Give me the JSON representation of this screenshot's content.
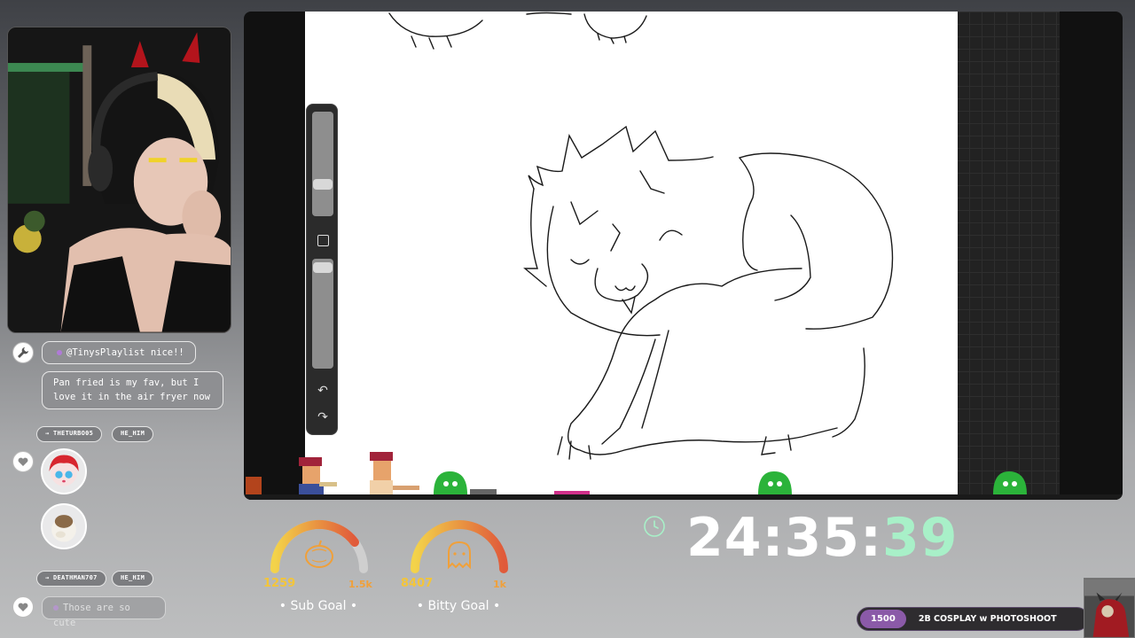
{
  "chat": {
    "messages": [
      {
        "text": "@TinysPlaylist nice!!"
      },
      {
        "text": "Pan fried is my fav, but I love it in the air fryer now"
      }
    ],
    "users": [
      {
        "name": "THETURBO05",
        "pronoun": "HE_HIM"
      },
      {
        "name": "DEATHMAN707",
        "pronoun": "HE_HIM"
      }
    ],
    "input_message": "Those are so cute"
  },
  "goals": {
    "sub": {
      "current": "1259",
      "max": "1.5k",
      "label": "• Sub Goal •",
      "progress": 0.84
    },
    "bitty": {
      "current": "8407",
      "max": "1k",
      "label": "• Bitty Goal •",
      "progress": 1.0
    }
  },
  "timer": {
    "hours_minutes": "24:35:",
    "seconds": "39"
  },
  "ticker": {
    "badge": "1500",
    "text": "2B COSPLAY w PHOTOSHOOT"
  },
  "colors": {
    "accent_purple": "#8b5aa8",
    "gauge_yellow": "#f3c53a",
    "gauge_red": "#e05a3a",
    "timer_green": "#a8f0c8",
    "bubble_gray": "#8e8f92"
  },
  "icons": {
    "wrench": "wrench-icon",
    "heart": "heart-icon",
    "clock": "clock-icon",
    "pumpkin": "pumpkin-icon",
    "ghost": "ghost-icon",
    "undo": "undo-icon",
    "redo": "redo-icon"
  }
}
